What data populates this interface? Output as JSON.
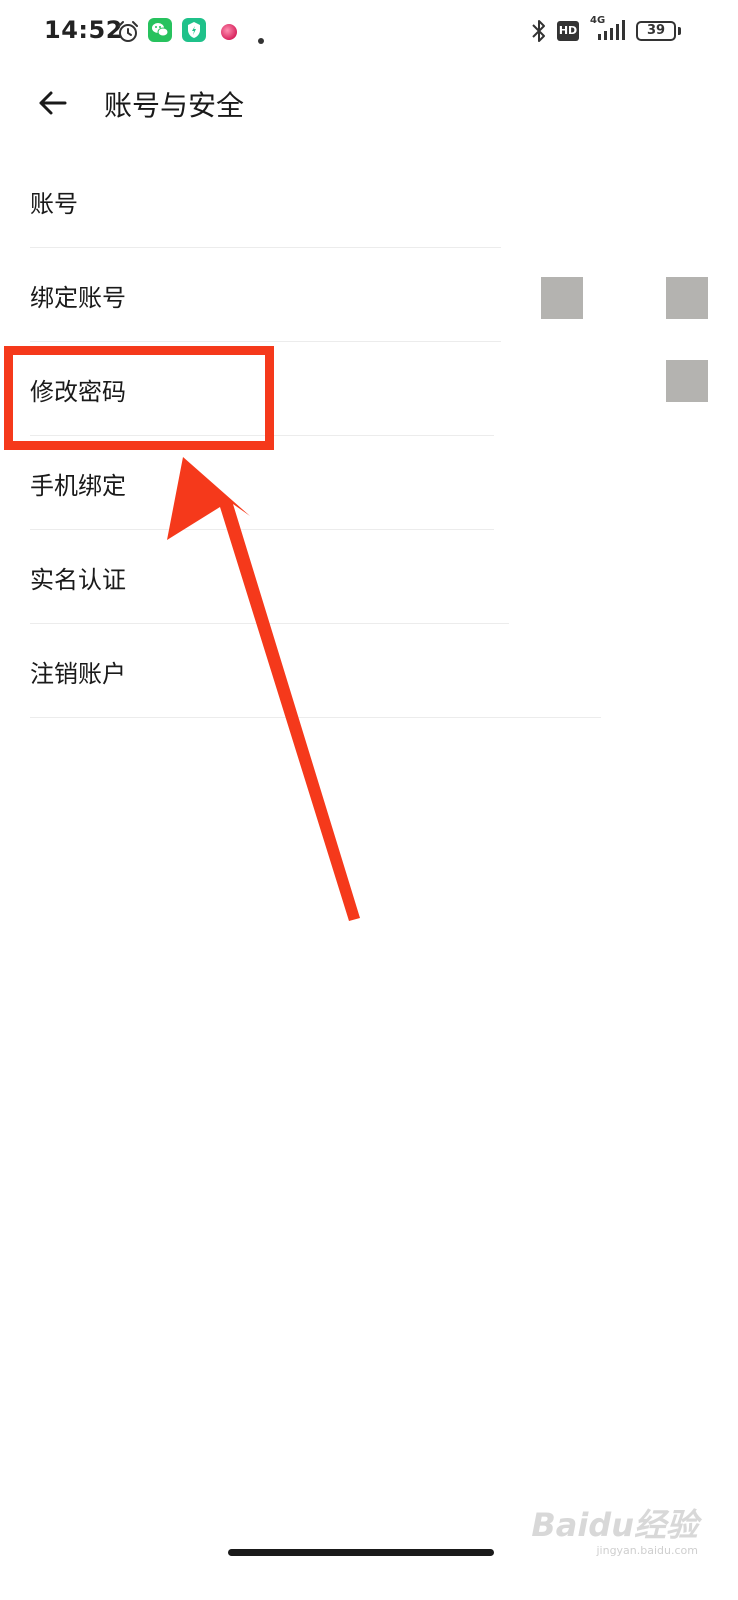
{
  "status_bar": {
    "time": "14:52",
    "network_type": "4G",
    "hd_label": "HD",
    "battery_level": "39",
    "icons": [
      "alarm-icon",
      "wechat-icon",
      "shield-app-icon",
      "pink-dot-icon",
      "small-dot-icon",
      "bluetooth-icon",
      "signal-icon"
    ]
  },
  "header": {
    "back_icon": "arrow-left-icon",
    "title": "账号与安全"
  },
  "settings": {
    "items": [
      {
        "label": "账号"
      },
      {
        "label": "绑定账号"
      },
      {
        "label": "修改密码"
      },
      {
        "label": "手机绑定"
      },
      {
        "label": "实名认证"
      },
      {
        "label": "注销账户"
      }
    ]
  },
  "annotation": {
    "highlighted_item": "修改密码",
    "color": "#f5391b"
  },
  "watermark": {
    "logo": "Baidu经验",
    "url": "jingyan.baidu.com"
  },
  "colors": {
    "background": "#ffffff",
    "text": "#1a1a1a",
    "divider": "#ececec",
    "placeholder": "#b4b3b0",
    "annotation_red": "#f5391b"
  }
}
